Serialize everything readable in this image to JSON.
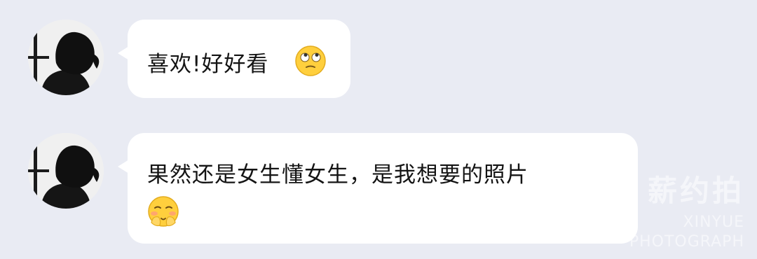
{
  "messages": [
    {
      "text": "喜欢!好好看",
      "emoji": "eye-roll-face-icon"
    },
    {
      "text": "果然还是女生懂女生，是我想要的照片",
      "emoji": "covering-mouth-face-icon"
    }
  ],
  "watermark": {
    "brand": "薪约拍",
    "tagline": "XINYUE PHOTOGRAPH"
  },
  "colors": {
    "background": "#e9ebf3",
    "bubble": "#ffffff",
    "text": "#141414",
    "emoji_yellow": "#ffcf3d"
  }
}
